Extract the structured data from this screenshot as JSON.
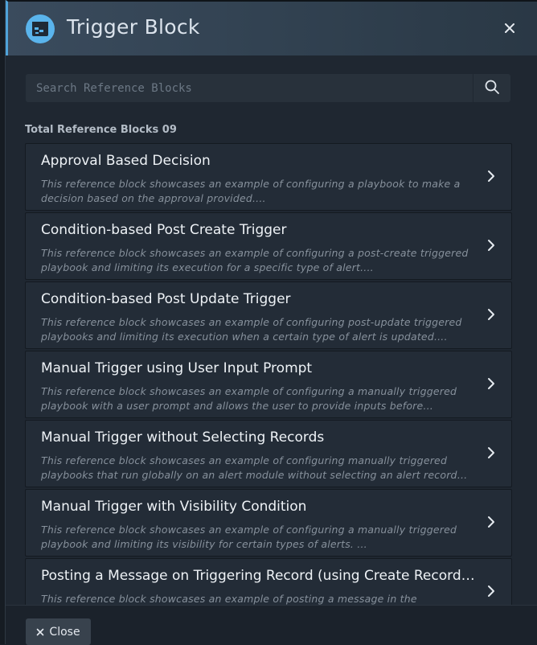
{
  "modal": {
    "title": "Trigger Block",
    "logo_icon": "playbook-block-icon",
    "close_icon": "close-icon"
  },
  "search": {
    "placeholder": "Search Reference Blocks",
    "value": "",
    "icon": "search-icon"
  },
  "total_label": "Total Reference Blocks 09",
  "blocks": [
    {
      "title": "Approval Based Decision",
      "description": "This reference block showcases an example of configuring a playbook to make a decision based on the approval provided...."
    },
    {
      "title": "Condition-based Post Create Trigger",
      "description": "This reference block showcases an example of configuring a post-create triggered playbook and limiting its execution for a specific type of alert...."
    },
    {
      "title": "Condition-based Post Update Trigger",
      "description": "This reference block showcases an example of configuring post-update triggered playbooks and limiting its execution when a certain type of alert is updated...."
    },
    {
      "title": "Manual Trigger using User Input Prompt",
      "description": "This reference block showcases an example of configuring a manually triggered playbook with a user prompt and allows the user to provide inputs before triggering..."
    },
    {
      "title": "Manual Trigger without Selecting Records",
      "description": "This reference block showcases an example of configuring manually triggered playbooks that run globally on an alert module without selecting an alert record an..."
    },
    {
      "title": "Manual Trigger with Visibility Condition",
      "description": "This reference block showcases an example of configuring a manually triggered playbook and limiting its visibility for certain types of alerts. ..."
    },
    {
      "title": "Posting a Message on Triggering Record (using Create Record St...",
      "description": "This reference block showcases an example of posting a message in the collaboration panel using the Create Record steps on the triggering record..."
    }
  ],
  "footer": {
    "close_label": "Close",
    "close_icon": "close-icon"
  },
  "colors": {
    "accent": "#5ab4ec",
    "background": "#1f2731",
    "card": "#232c37"
  }
}
